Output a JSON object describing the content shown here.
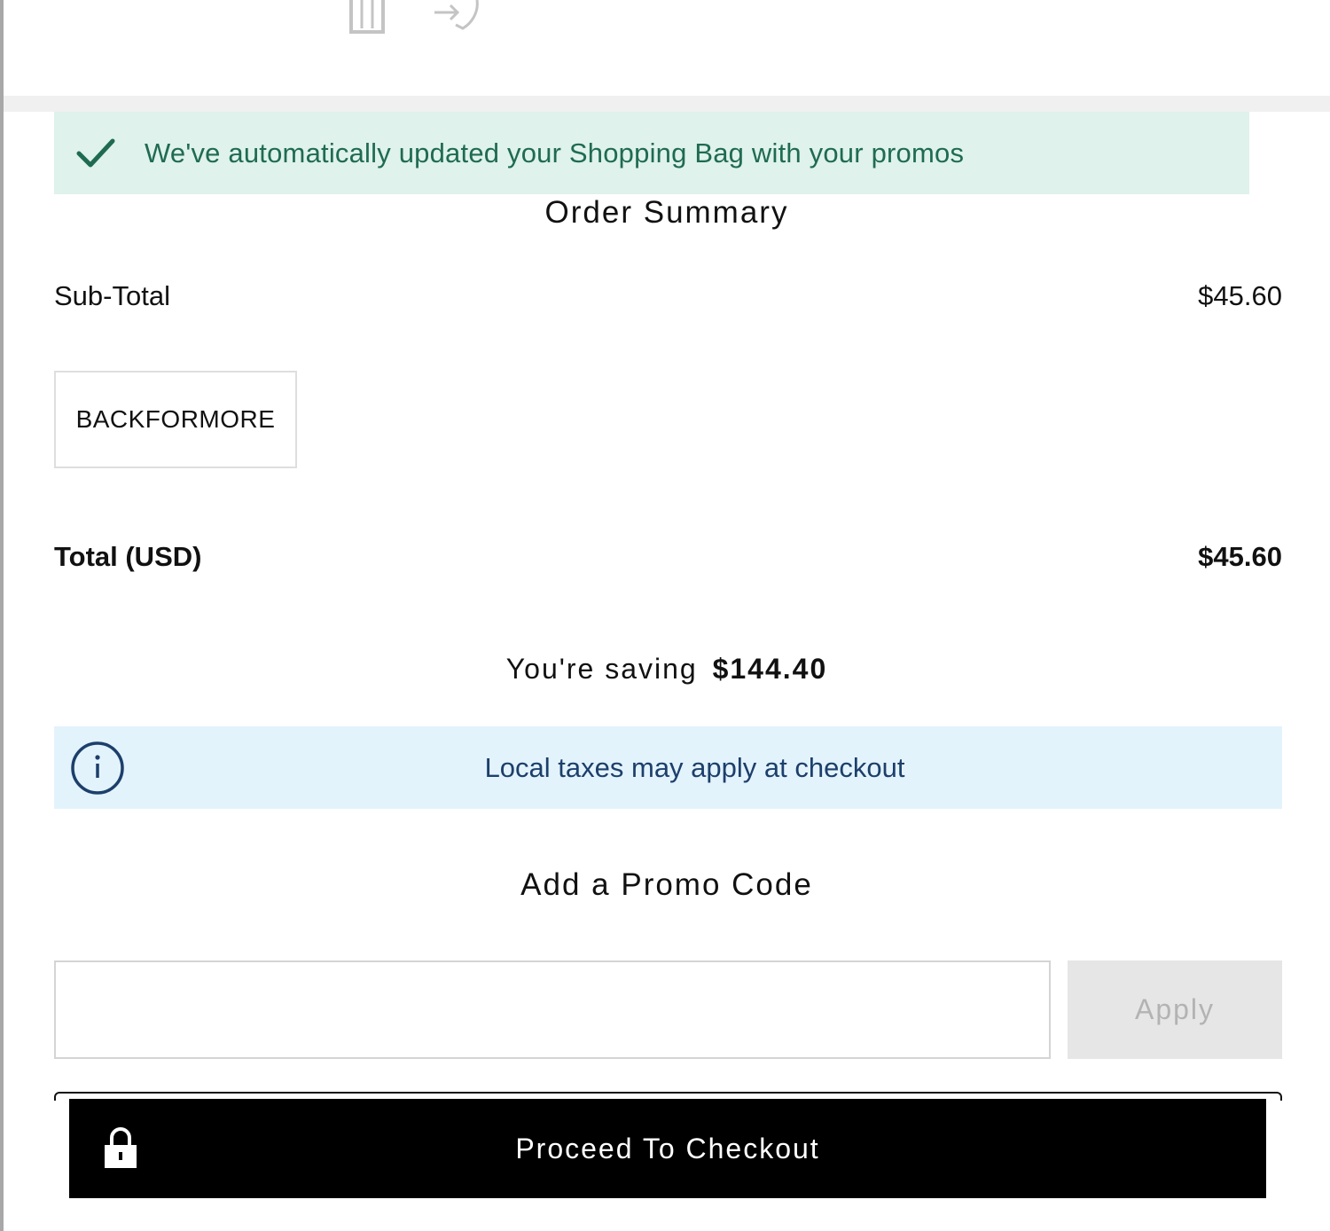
{
  "toolbar": {
    "icons": [
      "trash-icon",
      "move-to-wishlist-icon"
    ]
  },
  "promo_banner": {
    "icon": "check-icon",
    "text": "We've automatically updated your Shopping Bag with your promos",
    "color": "#1f6b51",
    "background": "#dff2ec"
  },
  "summary": {
    "title": "Order Summary",
    "subtotal_label": "Sub-Total",
    "subtotal_value": "$45.60",
    "applied_promo_code": "BACKFORMORE",
    "total_label": "Total (USD)",
    "total_value": "$45.60",
    "saving_label": "You're saving",
    "saving_value": "$144.40"
  },
  "tax_notice": {
    "icon": "info-icon",
    "text": "Local taxes may apply at checkout",
    "color": "#1c3f6b",
    "background": "#e3f3fc"
  },
  "promo_form": {
    "heading": "Add a Promo Code",
    "input_value": "",
    "input_placeholder": "",
    "apply_label": "Apply"
  },
  "checkout": {
    "icon": "lock-icon",
    "label": "Proceed To Checkout",
    "background": "#000000"
  }
}
